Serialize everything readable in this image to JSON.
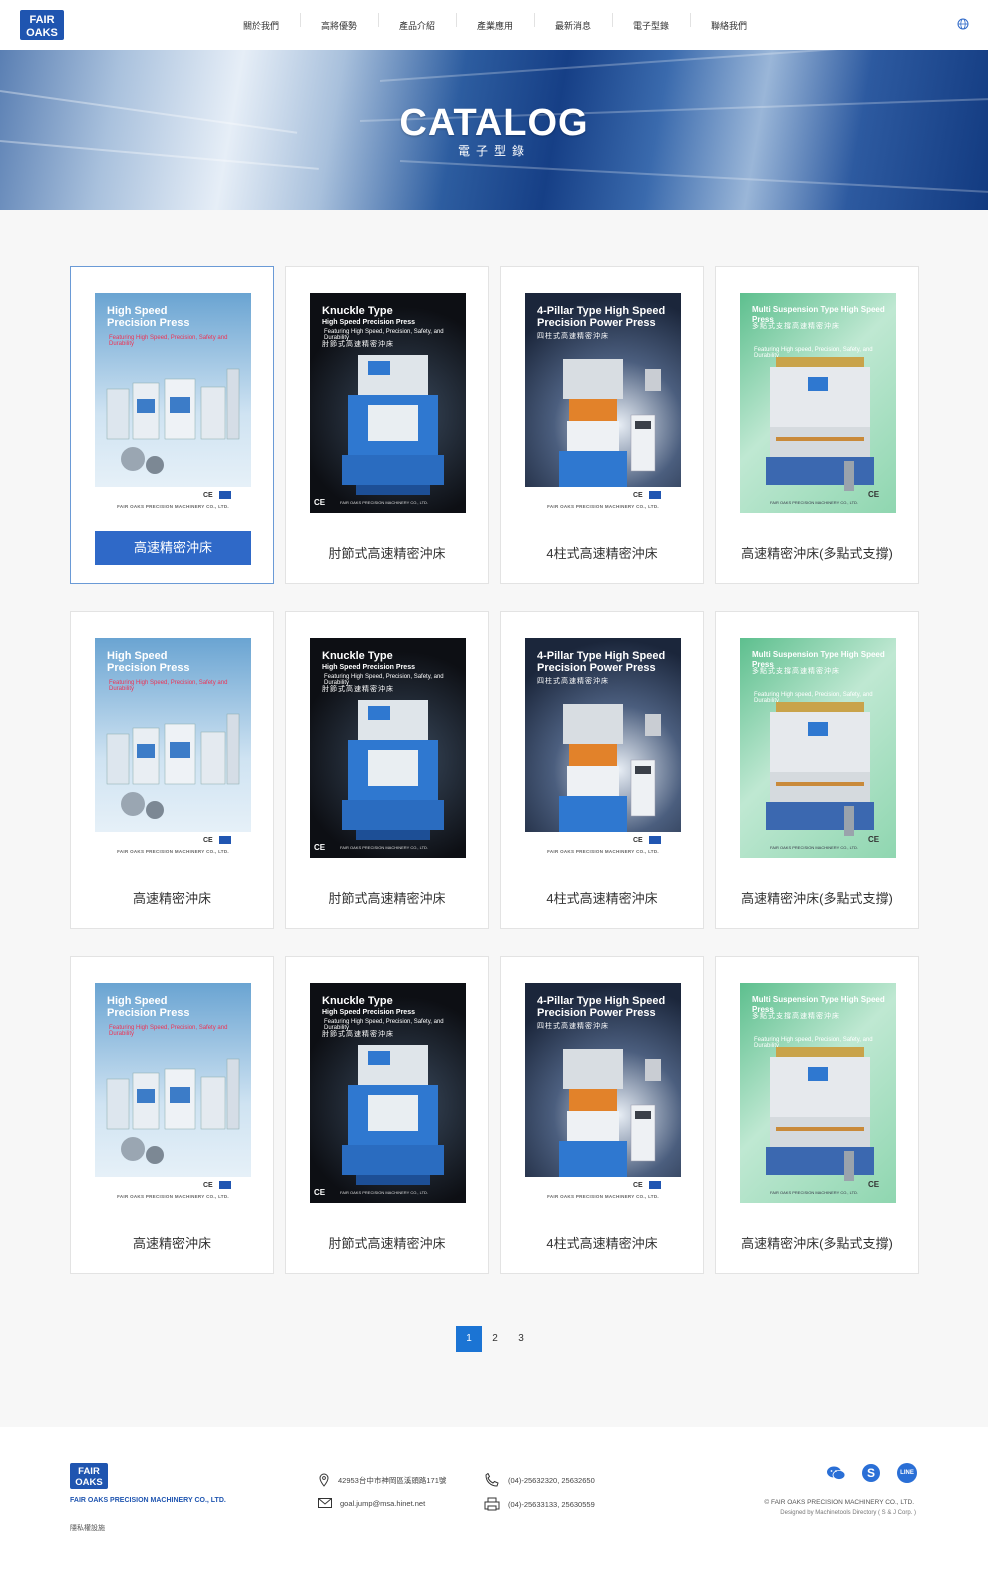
{
  "brand": {
    "logo_line1": "FAIR",
    "logo_line2": "OAKS"
  },
  "nav": {
    "items": [
      "關於我們",
      "高將優勢",
      "產品介紹",
      "產業應用",
      "最新消息",
      "電子型錄",
      "聯絡我們"
    ]
  },
  "banner": {
    "title": "CATALOG",
    "subtitle": "電子型錄"
  },
  "covers": {
    "a": {
      "title1": "High Speed",
      "title2": "Precision Press",
      "sub": "Featuring High Speed, Precision, Safety and Durability",
      "foot": "FAIR OAKS PRECISION MACHINERY CO., LTD.",
      "bg": "#7fb0d6"
    },
    "b": {
      "title1": "Knuckle Type",
      "title2": "High Speed Precision Press",
      "sub": "Featuring High Speed, Precision, Safety, and Durability",
      "chi": "肘節式高速精密沖床",
      "foot": "FAIR OAKS PRECISION MACHINERY CO., LTD.",
      "bg": "#0f1014"
    },
    "c": {
      "title1": "4-Pillar Type High Speed",
      "title2": "Precision Power Press",
      "chi": "四柱式高速精密沖床",
      "foot": "FAIR OAKS PRECISION MACHINERY CO., LTD.",
      "bg": "#1d2940"
    },
    "d": {
      "title1": "Multi Suspension Type High Speed Press",
      "chi": "多點式支撐高速精密沖床",
      "sub": "Featuring High speed, Precision, Safety, and Durability",
      "foot": "FAIR OAKS PRECISION MACHINERY CO., LTD.",
      "bg": "#7ed0a8"
    }
  },
  "mark_ce": "CE",
  "cards": [
    {
      "label": "高速精密沖床",
      "cover": "a"
    },
    {
      "label": "肘節式高速精密沖床",
      "cover": "b"
    },
    {
      "label": "4柱式高速精密沖床",
      "cover": "c"
    },
    {
      "label": "高速精密沖床(多點式支撐)",
      "cover": "d"
    },
    {
      "label": "高速精密沖床",
      "cover": "a"
    },
    {
      "label": "肘節式高速精密沖床",
      "cover": "b"
    },
    {
      "label": "4柱式高速精密沖床",
      "cover": "c"
    },
    {
      "label": "高速精密沖床(多點式支撐)",
      "cover": "d"
    },
    {
      "label": "高速精密沖床",
      "cover": "a"
    },
    {
      "label": "肘節式高速精密沖床",
      "cover": "b"
    },
    {
      "label": "4柱式高速精密沖床",
      "cover": "c"
    },
    {
      "label": "高速精密沖床(多點式支撐)",
      "cover": "d"
    }
  ],
  "pagination": {
    "pages": [
      "1",
      "2",
      "3"
    ],
    "current": "1"
  },
  "footer": {
    "company": "FAIR OAKS PRECISION MACHINERY CO., LTD.",
    "privacy": "隱私權設施",
    "address": "42953台中市神岡區溪頭路171號",
    "email": "goal.jump@msa.hinet.net",
    "phone": "(04)-25632320, 25632650",
    "fax": "(04)-25633133, 25630559",
    "copyright": "© FAIR OAKS PRECISION MACHINERY CO., LTD.",
    "designed_by": "Designed by Machinetools Directory ( S & J Corp. )",
    "social": [
      {
        "name": "wechat-icon",
        "color": "#2a6fd6"
      },
      {
        "name": "skype-icon",
        "color": "#2a6fd6"
      },
      {
        "name": "line-icon",
        "color": "#2a6fd6",
        "text": "LINE"
      }
    ]
  }
}
